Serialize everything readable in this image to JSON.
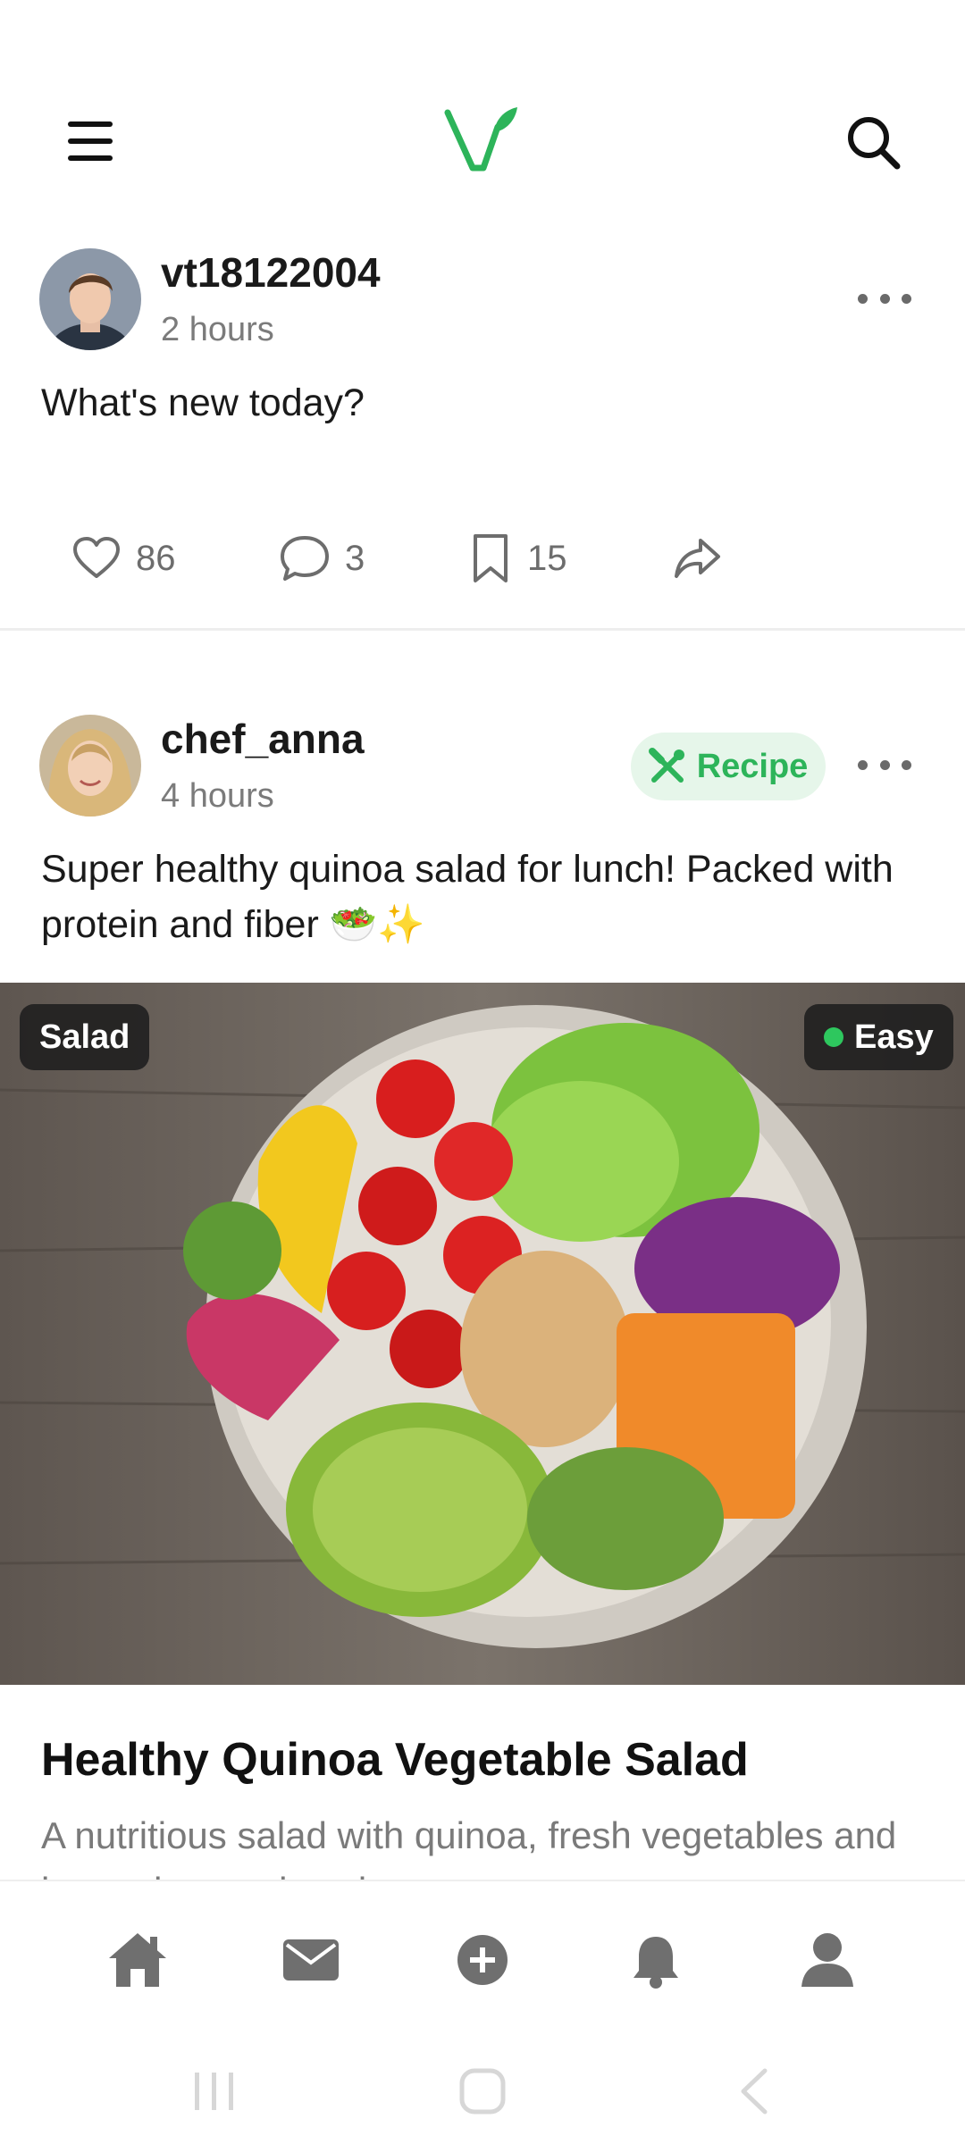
{
  "app": {
    "logo_icon": "vegan-leaf-logo",
    "accent_color": "#2db45a"
  },
  "header": {
    "menu_icon": "hamburger-menu-icon",
    "search_icon": "search-icon"
  },
  "posts": [
    {
      "username": "vt18122004",
      "time": "2 hours",
      "text": "What's new today?",
      "likes": "86",
      "comments": "3",
      "saves": "15"
    },
    {
      "username": "chef_anna",
      "time": "4 hours",
      "badge": "Recipe",
      "text": "Super healthy quinoa salad for lunch! Packed with protein and fiber 🥗✨",
      "image_tag": "Salad",
      "difficulty": "Easy",
      "recipe_title": "Healthy Quinoa Vegetable Salad",
      "recipe_description": "A nutritious salad with quinoa, fresh vegetables and lemon honey dressing"
    }
  ],
  "bottom_nav": [
    "home-icon",
    "messages-icon",
    "add-post-icon",
    "notifications-icon",
    "profile-icon"
  ],
  "system_nav": [
    "recent-apps-icon",
    "home-circle-icon",
    "back-icon"
  ]
}
